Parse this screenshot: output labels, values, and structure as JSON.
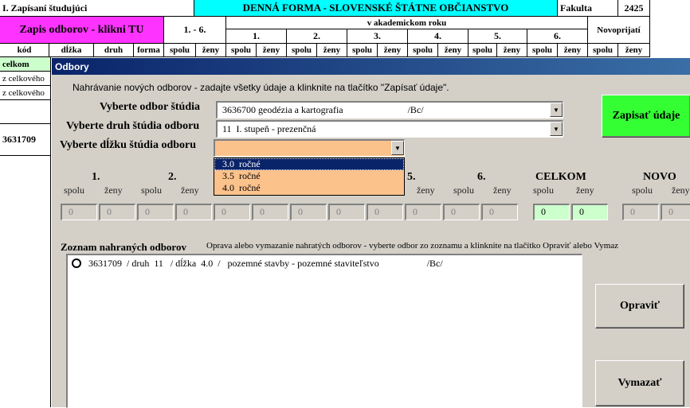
{
  "sheet": {
    "title": "I. Zapísaní študujúci",
    "banner": "DENNÁ FORMA - SLOVENSKÉ ŠTÁTNE OBČIANSTVO",
    "faculty_label": "Fakulta",
    "faculty_code": "2425",
    "zapis_button": "Zapis odborov - klikni TU",
    "range_label": "1. - 6.",
    "year_group": "v akademickom roku",
    "years": [
      "1.",
      "2.",
      "3.",
      "4.",
      "5.",
      "6."
    ],
    "novoprijati": "Novoprijatí",
    "headers": {
      "kod": "kód",
      "dlzka": "dĺžka",
      "druh": "druh",
      "forma": "forma",
      "spolu": "spolu",
      "zeny": "ženy"
    },
    "row_celkom": "celkom",
    "row_z1": "z celkového",
    "row_z2": "z celkového",
    "row_code": "3631709"
  },
  "dialog": {
    "title": "Odbory",
    "instruction": "Nahrávanie nových odborov - zadajte všetky údaje a klinknite na tlačítko \"Zapísať údaje\".",
    "odbor_label": "Vyberte odbor štúdia",
    "odbor_value": "3636700 geodézia a kartografia                           /Bc/",
    "druh_label": "Vyberte druh štúdia odboru",
    "druh_value": "11  I. stupeň - prezenčná",
    "dlzka_label": "Vyberte dĺžku štúdia odboru",
    "dlzka_value": "",
    "dlzka_options": [
      "3.0  ročné",
      "3.5  ročné",
      "4.0  ročné"
    ],
    "submit_button": "Zapisať údaje",
    "year_cols": [
      "1.",
      "2.",
      "5.",
      "6."
    ],
    "celkom": "CELKOM",
    "novo": "NOVO",
    "spolu": "spolu",
    "zeny": "ženy",
    "zero": "0",
    "list_title": "Zoznam nahraných odborov",
    "list_hint": "Oprava alebo vymazanie nahratých odborov - vyberte odbor zo zoznamu a klinknite na tlačítko Opraviť alebo Vymaz",
    "list_items": [
      "3631709  / druh  11   / dĺžka  4.0  /   pozemné stavby - pozemné staviteľstvo                    /Bc/"
    ],
    "edit_button": "Opraviť",
    "delete_button": "Vymazať"
  },
  "colors": {
    "banner": "#00ffff",
    "zapis": "#ff33ff",
    "celkom": "#ccffcc",
    "submit": "#33ff33",
    "dropdown": "#fcc28c",
    "selection": "#0a246a"
  }
}
